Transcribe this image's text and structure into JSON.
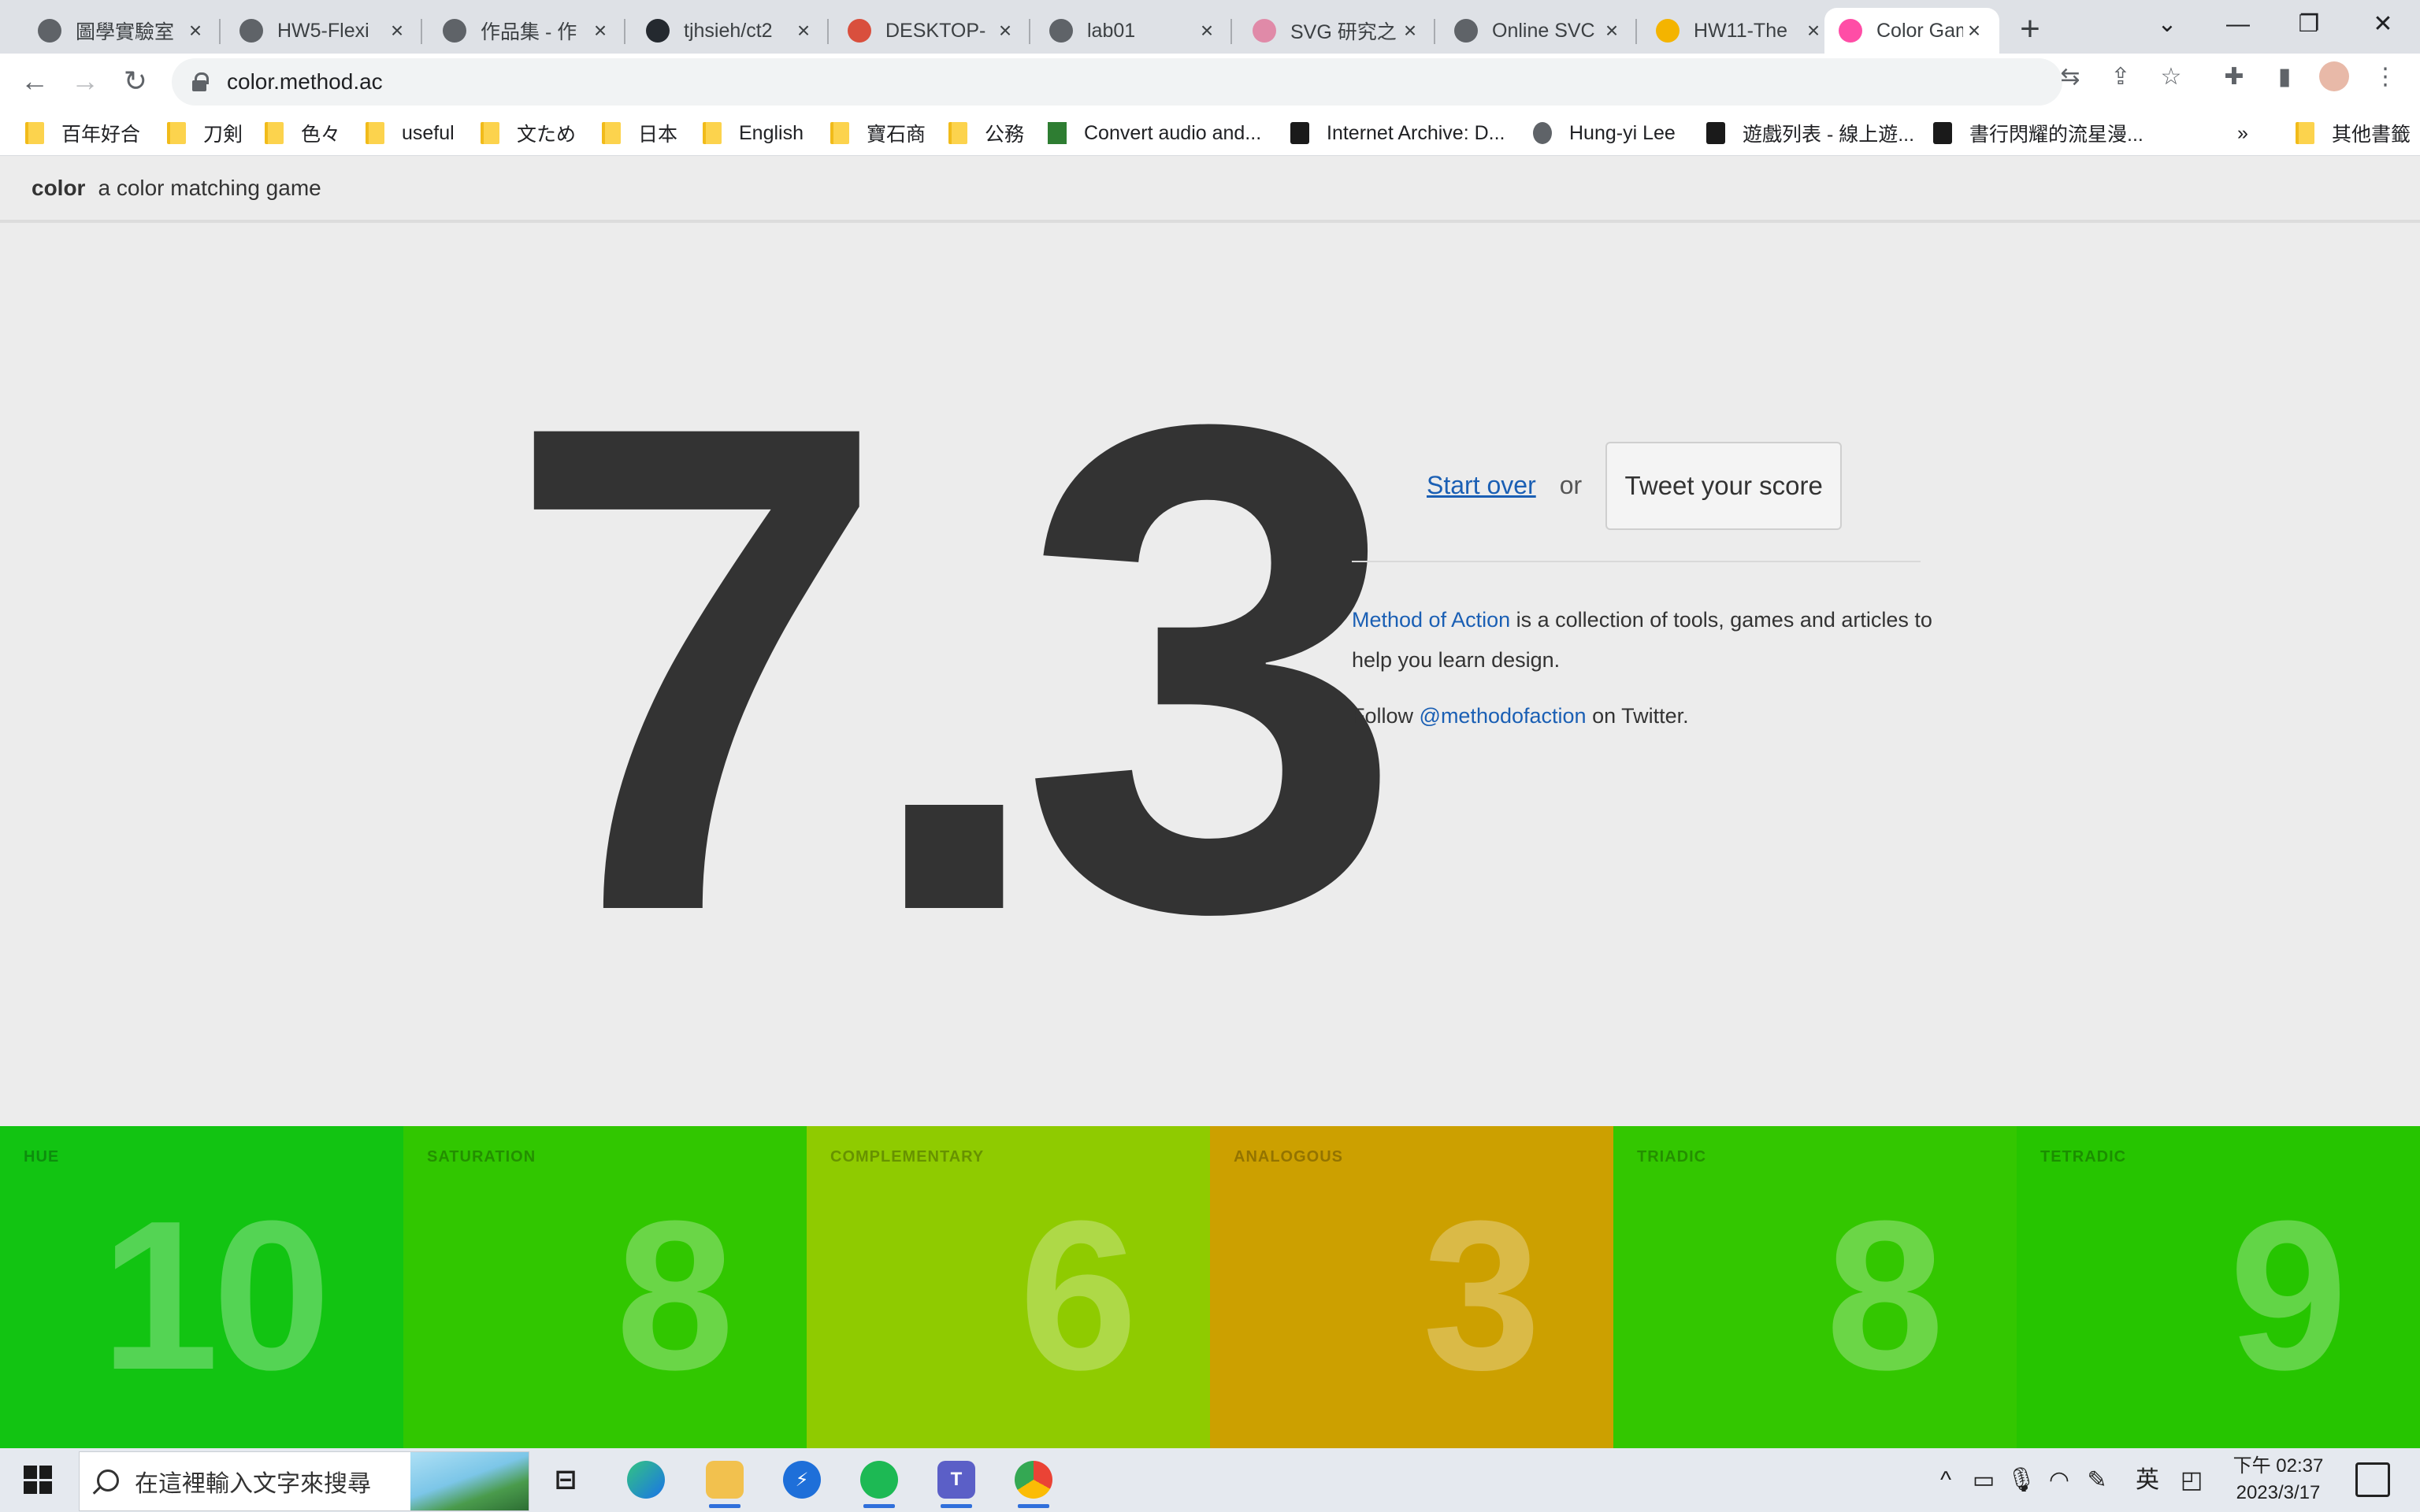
{
  "browser": {
    "tabs": [
      {
        "title": "圖學實驗室",
        "favicon": "globe-icon",
        "active": false
      },
      {
        "title": "HW5-Flexi",
        "favicon": "globe-icon",
        "active": false
      },
      {
        "title": "作品集 - 作",
        "favicon": "globe-icon",
        "active": false
      },
      {
        "title": "tjhsieh/ct2",
        "favicon": "github-icon",
        "active": false
      },
      {
        "title": "DESKTOP-",
        "favicon": "remote-desktop-icon",
        "active": false
      },
      {
        "title": "lab01",
        "favicon": "globe-icon",
        "active": false
      },
      {
        "title": "SVG 研究之",
        "favicon": "svg-site-icon",
        "active": false
      },
      {
        "title": "Online SVC",
        "favicon": "globe-icon",
        "active": false
      },
      {
        "title": "HW11-The",
        "favicon": "slides-icon",
        "active": false
      },
      {
        "title": "Color Gam",
        "favicon": "color-wheel-icon",
        "active": true
      }
    ],
    "new_tab_glyph": "+",
    "url": "color.method.ac"
  },
  "bookmarks": [
    {
      "label": "百年好合",
      "icon": "folder"
    },
    {
      "label": "刀剣",
      "icon": "folder"
    },
    {
      "label": "色々",
      "icon": "folder"
    },
    {
      "label": "useful",
      "icon": "folder"
    },
    {
      "label": "文ため",
      "icon": "folder"
    },
    {
      "label": "日本",
      "icon": "folder"
    },
    {
      "label": "English",
      "icon": "folder"
    },
    {
      "label": "寶石商",
      "icon": "folder"
    },
    {
      "label": "公務",
      "icon": "folder"
    },
    {
      "label": "Convert audio and...",
      "icon": "green"
    },
    {
      "label": "Internet Archive: D...",
      "icon": "dark"
    },
    {
      "label": "Hung-yi Lee",
      "icon": "globe"
    },
    {
      "label": "遊戲列表 - 線上遊...",
      "icon": "dark"
    },
    {
      "label": "書行閃耀的流星漫...",
      "icon": "dark"
    },
    {
      "label": "»",
      "icon": "none"
    },
    {
      "label": "其他書籤",
      "icon": "folder"
    }
  ],
  "site": {
    "name": "color",
    "tagline": "a color matching game"
  },
  "result": {
    "score": "7.3",
    "start_over": "Start over",
    "or": "or",
    "tweet": "Tweet your score"
  },
  "about": {
    "link": "Method of Action",
    "text": " is a collection of tools, games and articles to help you learn design.",
    "follow_prefix": "Follow ",
    "handle": "@methodofaction",
    "follow_suffix": " on Twitter."
  },
  "tiles": [
    {
      "label": "HUE",
      "value": "10",
      "color": "#12c412"
    },
    {
      "label": "SATURATION",
      "value": "8",
      "color": "#31c700"
    },
    {
      "label": "COMPLEMENTARY",
      "value": "6",
      "color": "#8fcb00"
    },
    {
      "label": "ANALOGOUS",
      "value": "3",
      "color": "#cca000"
    },
    {
      "label": "TRIADIC",
      "value": "8",
      "color": "#33c700"
    },
    {
      "label": "TETRADIC",
      "value": "9",
      "color": "#26c500"
    }
  ],
  "taskbar": {
    "search_placeholder": "在這裡輸入文字來搜尋",
    "ime": "英",
    "time": "下午 02:37",
    "date": "2023/3/17"
  }
}
